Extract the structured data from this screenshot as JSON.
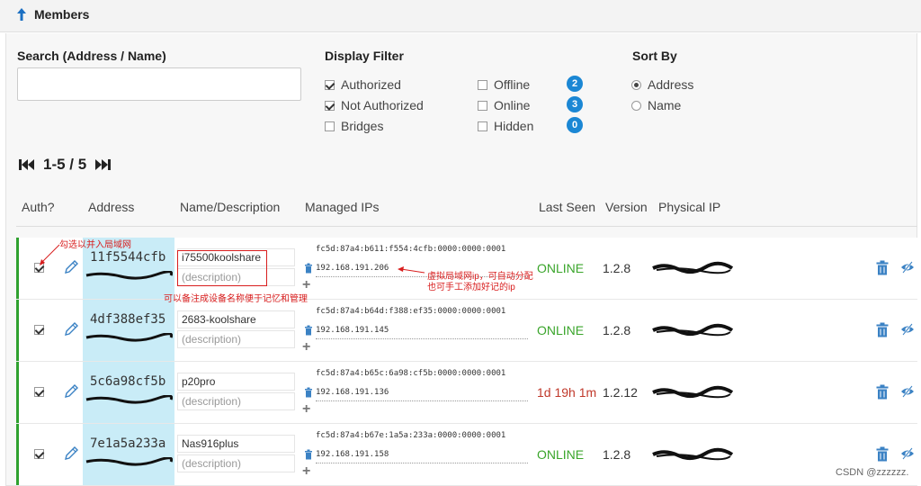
{
  "header": {
    "title": "Members",
    "icon": "arrow-up-icon"
  },
  "search": {
    "label": "Search (Address / Name)",
    "value": "",
    "placeholder": ""
  },
  "display_filter": {
    "label": "Display Filter",
    "options": [
      {
        "label": "Authorized",
        "checked": true
      },
      {
        "label": "Not Authorized",
        "checked": true
      },
      {
        "label": "Bridges",
        "checked": false
      },
      {
        "label": "Offline",
        "checked": false,
        "count": "2"
      },
      {
        "label": "Online",
        "checked": false,
        "count": "3"
      },
      {
        "label": "Hidden",
        "checked": false,
        "count": "0"
      }
    ]
  },
  "sort_by": {
    "label": "Sort By",
    "options": [
      {
        "label": "Address",
        "selected": true
      },
      {
        "label": "Name",
        "selected": false
      }
    ]
  },
  "pager": {
    "text": "1-5 / 5"
  },
  "columns": [
    "Auth?",
    "Address",
    "Name/Description",
    "Managed IPs",
    "Last Seen",
    "Version",
    "Physical IP"
  ],
  "members": [
    {
      "address": "11f5544cfb",
      "name": "i75500koolshare",
      "description": "(description)",
      "ip6": "fc5d:87a4:b611:f554:4cfb:0000:0000:0001",
      "ip4": "192.168.191.206",
      "last_seen": "ONLINE",
      "version": "1.2.8",
      "authorized": true
    },
    {
      "address": "4df388ef35",
      "name": "2683-koolshare",
      "description": "(description)",
      "ip6": "fc5d:87a4:b64d:f388:ef35:0000:0000:0001",
      "ip4": "192.168.191.145",
      "last_seen": "ONLINE",
      "version": "1.2.8",
      "authorized": true
    },
    {
      "address": "5c6a98cf5b",
      "name": "p20pro",
      "description": "(description)",
      "ip6": "fc5d:87a4:b65c:6a98:cf5b:0000:0000:0001",
      "ip4": "192.168.191.136",
      "last_seen": "1d 19h 1m",
      "version": "1.2.12",
      "authorized": true
    },
    {
      "address": "7e1a5a233a",
      "name": "Nas916plus",
      "description": "(description)",
      "ip6": "fc5d:87a4:b67e:1a5a:233a:0000:0000:0001",
      "ip4": "192.168.191.158",
      "last_seen": "ONLINE",
      "version": "1.2.8",
      "authorized": true
    }
  ],
  "annotations": {
    "auth_note": "勾选以并入局域网",
    "name_note": "可以备注成设备名称便于记忆和管理",
    "ip_note_line1": "虚拟局域网ip，可自动分配",
    "ip_note_line2": "也可手工添加好记的ip"
  },
  "watermark": "CSDN @zzzzzz.",
  "colors": {
    "online": "#3aa52b",
    "offline": "#c0392b",
    "accent": "#1b87d4",
    "row_bar": "#2fa12f",
    "address_bg": "#c9ecf7",
    "annotation": "#d81e1e"
  }
}
